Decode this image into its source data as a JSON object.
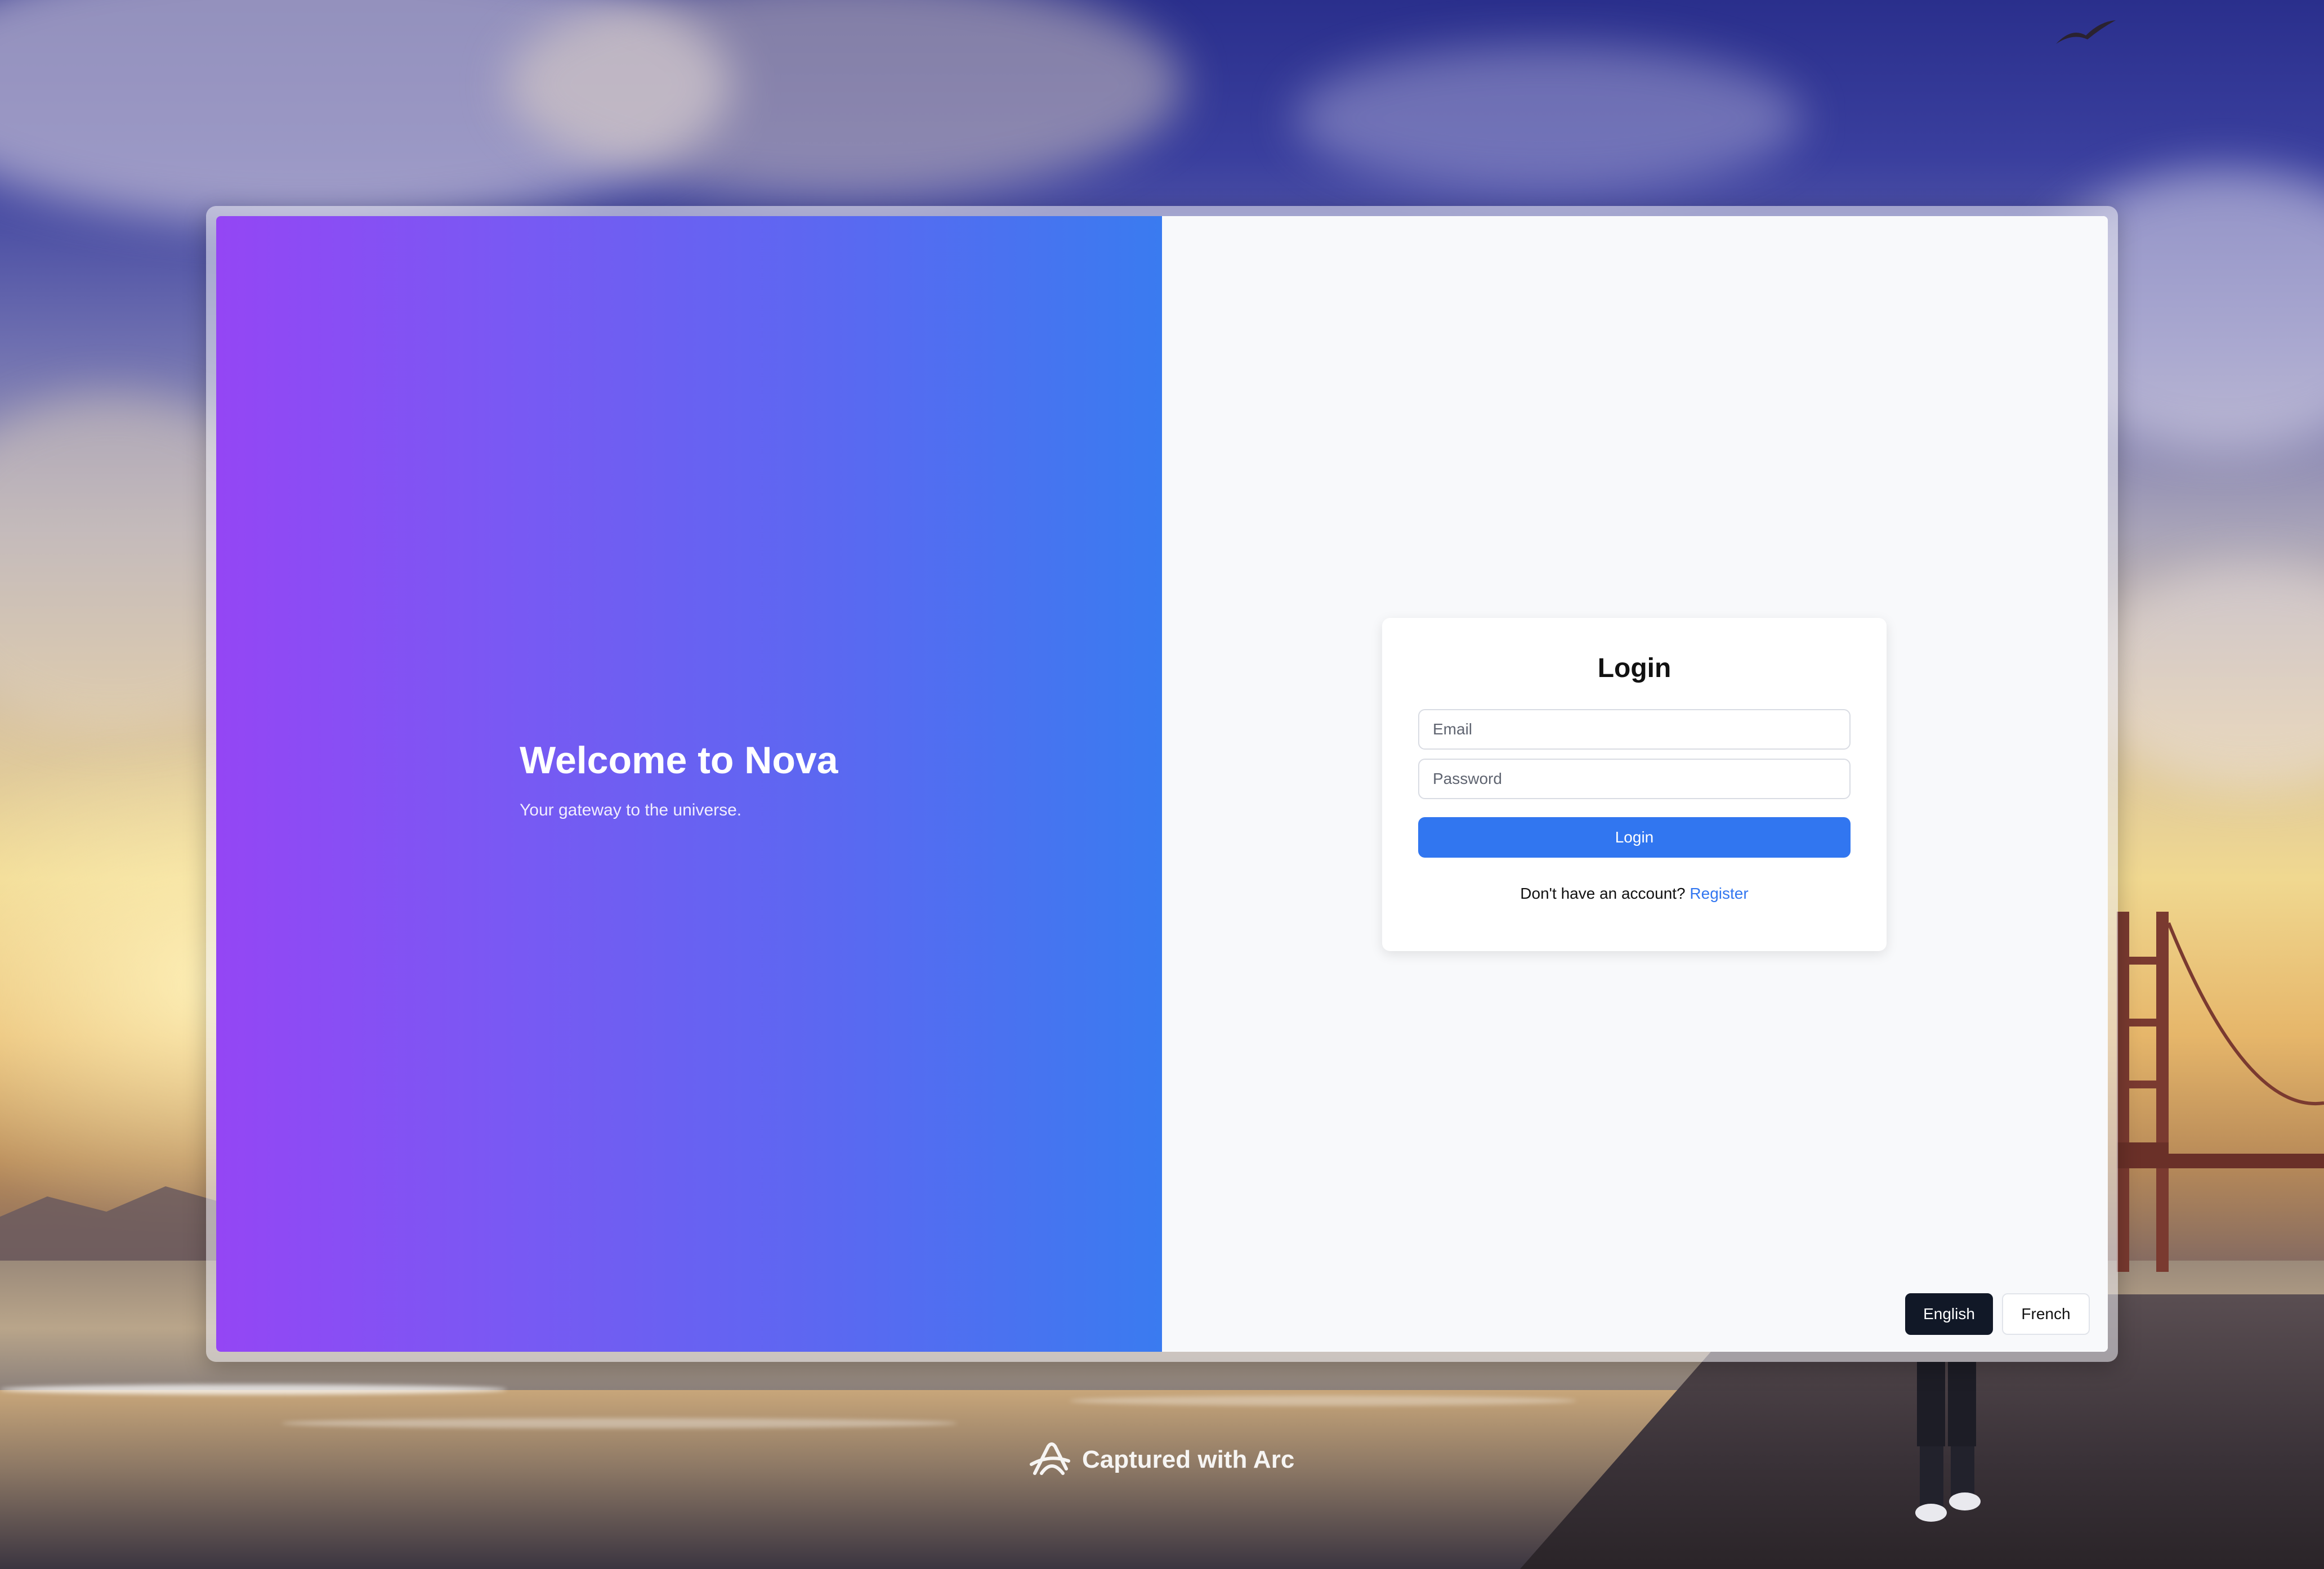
{
  "hero": {
    "title": "Welcome to Nova",
    "subtitle": "Your gateway to the universe."
  },
  "login": {
    "title": "Login",
    "email_placeholder": "Email",
    "password_placeholder": "Password",
    "submit_label": "Login",
    "signup_prompt": "Don't have an account?",
    "register_label": "Register"
  },
  "language": {
    "options": [
      "English",
      "French"
    ],
    "selected": "English"
  },
  "caption": {
    "text": "Captured with Arc",
    "icon": "arc-logo-icon"
  },
  "colors": {
    "gradient_start": "#9446f4",
    "gradient_end": "#3a7bf0",
    "primary": "#3176f0",
    "dark": "#111827",
    "panel_bg": "#f8f9fb"
  }
}
